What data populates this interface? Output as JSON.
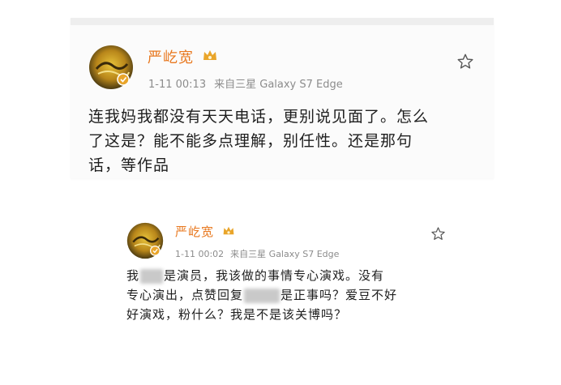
{
  "post1": {
    "username": "严屹宽",
    "date": "1-11 00:13",
    "source": "来自三星 Galaxy S7 Edge",
    "lines": [
      "连我妈我都没有天天电话，更别说见面了。怎么",
      "了这是？能不能多点理解，别任性。还是那句",
      "话，等作品"
    ]
  },
  "post2": {
    "username": "严屹宽",
    "date": "1-11 00:02",
    "source": "来自三星 Galaxy S7 Edge",
    "line1_a": "我",
    "line1_b": "是演员，我该做的事情专心演戏。没有",
    "line2_a": "专心演出，点赞回复",
    "line2_b": "是正事吗？爱豆不好",
    "line3": "好演戏，粉什么？我是不是该关博吗？"
  },
  "colors": {
    "username": "#e8781f",
    "meta": "#8c8c8c",
    "text": "#1e1e1e",
    "vip_badge": "#e9a52a"
  },
  "icons": {
    "avatar": "avatar",
    "vip": "vip-crown-icon",
    "verified": "verified-badge-icon",
    "star": "star-icon"
  }
}
